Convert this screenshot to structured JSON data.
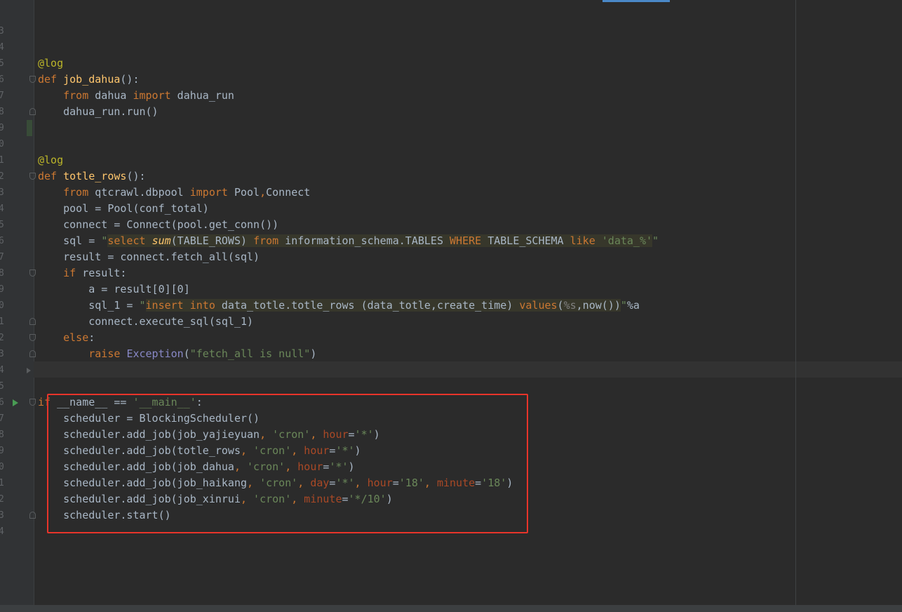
{
  "gutter": {
    "line_numbers": [
      "3",
      "4",
      "5",
      "6",
      "7",
      "8",
      "9",
      "0",
      "1",
      "2",
      "3",
      "4",
      "5",
      "6",
      "7",
      "8",
      "9",
      "0",
      "1",
      "2",
      "3",
      "4",
      "5",
      "6",
      "7",
      "8",
      "9",
      "0",
      "1",
      "2",
      "3",
      "4"
    ]
  },
  "code": {
    "lines": [
      "",
      "",
      "@log",
      "def job_dahua():",
      "    from dahua import dahua_run",
      "    dahua_run.run()",
      "",
      "",
      "@log",
      "def totle_rows():",
      "    from qtcrawl.dbpool import Pool,Connect",
      "    pool = Pool(conf_total)",
      "    connect = Connect(pool.get_conn())",
      "    sql = \"select sum(TABLE_ROWS) from information_schema.TABLES WHERE TABLE_SCHEMA like 'data_%'\"",
      "    result = connect.fetch_all(sql)",
      "    if result:",
      "        a = result[0][0]",
      "        sql_1 = \"insert into data_totle.totle_rows (data_totle,create_time) values(%s,now())\"%a",
      "        connect.execute_sql(sql_1)",
      "    else:",
      "        raise Exception(\"fetch_all is null\")",
      "",
      "",
      "if __name__ == '__main__':",
      "    scheduler = BlockingScheduler()",
      "    scheduler.add_job(job_yajieyuan, 'cron', hour='*')",
      "    scheduler.add_job(totle_rows, 'cron', hour='*')",
      "    scheduler.add_job(job_dahua, 'cron', hour='*')",
      "    scheduler.add_job(job_haikang, 'cron', day='*', hour='18', minute='18')",
      "    scheduler.add_job(job_xinrui, 'cron', minute='*/10')",
      "    scheduler.start()",
      ""
    ]
  },
  "colors": {
    "background": "#2b2b2b",
    "keyword": "#cc7832",
    "function": "#ffc66d",
    "decorator": "#bbb529",
    "string": "#6a8759",
    "text": "#a9b7c6",
    "highlight_box": "#e8342a",
    "run_icon": "#499c54"
  },
  "icons": [
    "run-icon",
    "fold-icon",
    "collapse-arrow-icon"
  ]
}
